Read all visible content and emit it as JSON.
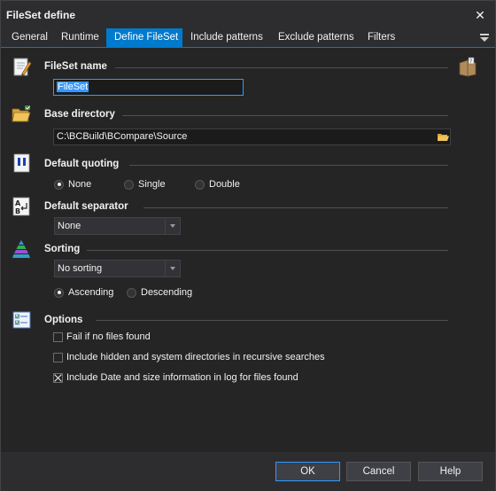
{
  "window": {
    "title": "FileSet define"
  },
  "tabs": [
    {
      "label": "General"
    },
    {
      "label": "Runtime"
    },
    {
      "label": "Define FileSet"
    },
    {
      "label": "Include patterns"
    },
    {
      "label": "Exclude patterns"
    },
    {
      "label": "Filters"
    }
  ],
  "active_tab": "Define FileSet",
  "fileset_name": {
    "title": "FileSet name",
    "value": "FileSet"
  },
  "base_directory": {
    "title": "Base directory",
    "value": "C:\\BCBuild\\BCompare\\Source"
  },
  "default_quoting": {
    "title": "Default quoting",
    "options": [
      "None",
      "Single",
      "Double"
    ],
    "selected": "None"
  },
  "default_separator": {
    "title": "Default separator",
    "value": "None"
  },
  "sorting": {
    "title": "Sorting",
    "value": "No sorting",
    "order_options": [
      "Ascending",
      "Descending"
    ],
    "selected_order": "Ascending"
  },
  "options": {
    "title": "Options",
    "items": [
      {
        "label": "Fail if no files found",
        "checked": false
      },
      {
        "label": "Include hidden and system directories in recursive searches",
        "checked": false
      },
      {
        "label": "Include Date and size information in log for files found",
        "checked": true
      }
    ]
  },
  "buttons": {
    "ok": "OK",
    "cancel": "Cancel",
    "help": "Help"
  },
  "colors": {
    "accent": "#007acc",
    "background": "#252526",
    "chrome": "#2d2d30"
  },
  "icons": [
    "notepad-pencil-icon",
    "folder-icon",
    "quote-icon",
    "separator-icon",
    "sort-pyramid-icon",
    "options-checklist-icon",
    "help-book-icon",
    "browse-folder-icon",
    "tab-menu-icon",
    "close-icon"
  ]
}
